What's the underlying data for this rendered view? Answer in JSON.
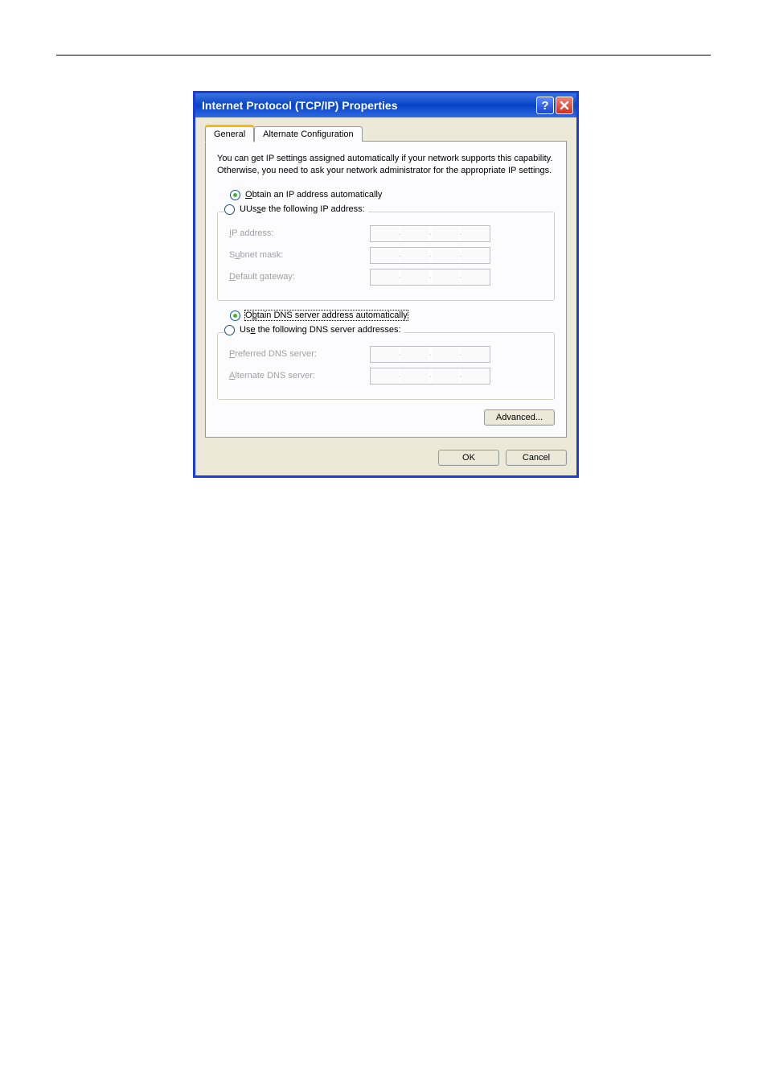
{
  "dialog": {
    "title": "Internet Protocol (TCP/IP) Properties"
  },
  "tabs": {
    "general": "General",
    "alternate": "Alternate Configuration"
  },
  "description": "You can get IP settings assigned automatically if your network supports this capability. Otherwise, you need to ask your network administrator for the appropriate IP settings.",
  "ip": {
    "auto_label": "btain an IP address automatically",
    "auto_prefix": "O",
    "manual_label": "e the following IP address:",
    "manual_prefix": "Us",
    "ip_label": "P address:",
    "ip_prefix": "I",
    "subnet_label": "bnet mask:",
    "subnet_prefix": "Su",
    "gateway_label": "efault gateway:",
    "gateway_prefix": "D"
  },
  "dns": {
    "auto_label": "tain DNS server address automatically",
    "auto_prefix": "Ob",
    "manual_label": " the following DNS server addresses:",
    "manual_prefix": "Use",
    "preferred_label": "referred DNS server:",
    "preferred_prefix": "P",
    "alternate_label": "lternate DNS server:",
    "alternate_prefix": "A"
  },
  "buttons": {
    "advanced": "vanced...",
    "advanced_prefix": "Ad",
    "ok": "OK",
    "cancel": "Cancel"
  }
}
